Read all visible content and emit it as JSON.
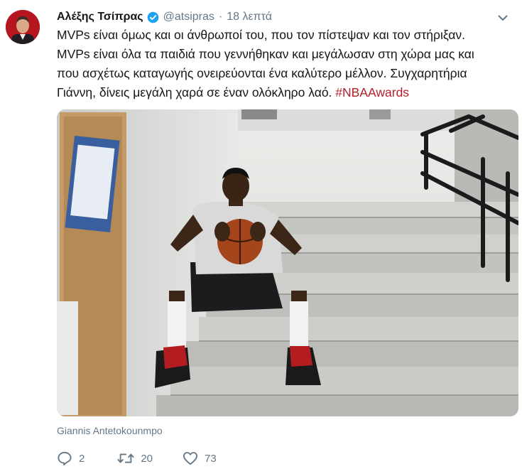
{
  "tweet": {
    "author_name": "Αλέξης Τσίπρας",
    "handle": "@atsipras",
    "separator": "·",
    "time": "18 λεπτά",
    "text_lines": [
      "MVPs είναι όμως και οι άνθρωποί του, που τον πίστεψαν και τον στήριξαν.",
      "MVPs είναι όλα τα παιδιά που γεννήθηκαν και μεγάλωσαν στη χώρα μας και",
      "που ασχέτως καταγωγής ονειρεύονται ένα καλύτερο μέλλον. Συγχαρητήρια",
      "Γιάννη, δίνεις μεγάλη χαρά σε έναν ολόκληρο λαό."
    ],
    "hashtag": "#NBAAwards",
    "media_caption": "Giannis Antetokounmpo",
    "actions": {
      "reply_count": "2",
      "retweet_count": "20",
      "like_count": "73"
    }
  },
  "colors": {
    "text": "#14171a",
    "secondary": "#657786",
    "verified": "#1da1f2",
    "hashtag": "#b3202a"
  },
  "icons": {
    "verified": "verified-badge-icon",
    "caret": "chevron-down-icon",
    "reply": "reply-icon",
    "retweet": "retweet-icon",
    "like": "heart-icon"
  }
}
